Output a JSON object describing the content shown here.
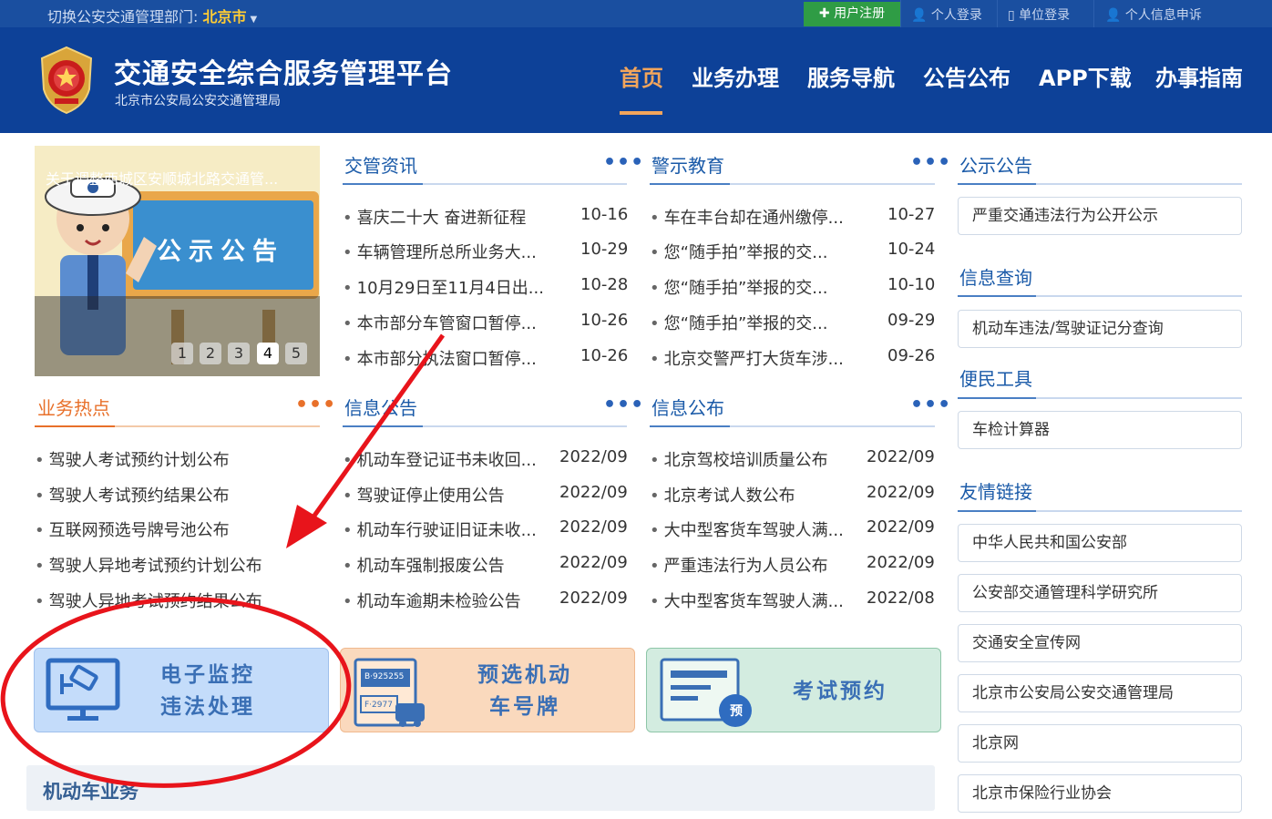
{
  "topbar": {
    "switch_label": "切换公安交通管理部门:",
    "city": "北京市",
    "register": "用户注册",
    "links": [
      "个人登录",
      "单位登录",
      "个人信息申诉"
    ]
  },
  "header": {
    "title": "交通安全综合服务管理平台",
    "subtitle": "北京市公安局公安交通管理局",
    "nav": [
      "首页",
      "业务办理",
      "服务导航",
      "公告公布",
      "APP下载",
      "办事指南"
    ]
  },
  "banner": {
    "sign_text": "公示公告",
    "caption": "关于调整西城区安顺城北路交通管...",
    "pages": [
      "1",
      "2",
      "3",
      "4",
      "5"
    ],
    "active_page": "4"
  },
  "sections": {
    "jiaoguan": {
      "title": "交管资讯",
      "items": [
        {
          "text": "喜庆二十大 奋进新征程",
          "date": "10-16"
        },
        {
          "text": "车辆管理所总所业务大...",
          "date": "10-29"
        },
        {
          "text": "10月29日至11月4日出...",
          "date": "10-28"
        },
        {
          "text": "本市部分车管窗口暂停...",
          "date": "10-26"
        },
        {
          "text": "本市部分执法窗口暂停...",
          "date": "10-26"
        }
      ]
    },
    "jingshi": {
      "title": "警示教育",
      "items": [
        {
          "text": "车在丰台却在通州缴停...",
          "date": "10-27"
        },
        {
          "text": "您“随手拍”举报的交...",
          "date": "10-24"
        },
        {
          "text": "您“随手拍”举报的交...",
          "date": "10-10"
        },
        {
          "text": "您“随手拍”举报的交...",
          "date": "09-29"
        },
        {
          "text": "北京交警严打大货车涉...",
          "date": "09-26"
        }
      ]
    },
    "hot": {
      "title": "业务热点",
      "items": [
        "驾驶人考试预约计划公布",
        "驾驶人考试预约结果公布",
        "互联网预选号牌号池公布",
        "驾驶人异地考试预约计划公布",
        "驾驶人异地考试预约结果公布"
      ]
    },
    "xinxi_gonggao": {
      "title": "信息公告",
      "items": [
        {
          "text": "机动车登记证书未收回...",
          "date": "2022/09"
        },
        {
          "text": "驾驶证停止使用公告",
          "date": "2022/09"
        },
        {
          "text": "机动车行驶证旧证未收...",
          "date": "2022/09"
        },
        {
          "text": "机动车强制报废公告",
          "date": "2022/09"
        },
        {
          "text": "机动车逾期未检验公告",
          "date": "2022/09"
        }
      ]
    },
    "xinxi_gongbu": {
      "title": "信息公布",
      "items": [
        {
          "text": "北京驾校培训质量公布",
          "date": "2022/09"
        },
        {
          "text": "北京考试人数公布",
          "date": "2022/09"
        },
        {
          "text": "大中型客货车驾驶人满...",
          "date": "2022/09"
        },
        {
          "text": "严重违法行为人员公布",
          "date": "2022/09"
        },
        {
          "text": "大中型客货车驾驶人满...",
          "date": "2022/08"
        }
      ]
    }
  },
  "right": {
    "gongshi": {
      "title": "公示公告",
      "items": [
        "严重交通违法行为公开公示"
      ]
    },
    "chaxun": {
      "title": "信息查询",
      "items": [
        "机动车违法/驾驶证记分查询"
      ]
    },
    "tools": {
      "title": "便民工具",
      "items": [
        "车检计算器"
      ]
    },
    "links": {
      "title": "友情链接",
      "items": [
        "中华人民共和国公安部",
        "公安部交通管理科学研究所",
        "交通安全宣传网",
        "北京市公安局公安交通管理局",
        "北京网",
        "北京市保险行业协会"
      ]
    }
  },
  "cards": [
    {
      "line1": "电子监控",
      "line2": "违法处理",
      "color": "#3a6fb5"
    },
    {
      "line1": "预选机动",
      "line2": "车号牌",
      "color": "#3a6fb5",
      "plate1": "B·925255",
      "plate2": "F·2977"
    },
    {
      "line1": "考试预约",
      "line2": "",
      "color": "#3a6fb5",
      "badge": "预"
    }
  ],
  "motor": {
    "title": "机动车业务"
  },
  "colors": {
    "header": "#0d4198",
    "topbar": "#1a4fa0",
    "accent_orange": "#e8702a",
    "link_blue": "#1a5aa8",
    "register_green": "#2f9c45",
    "annotation_red": "#e8141b"
  }
}
